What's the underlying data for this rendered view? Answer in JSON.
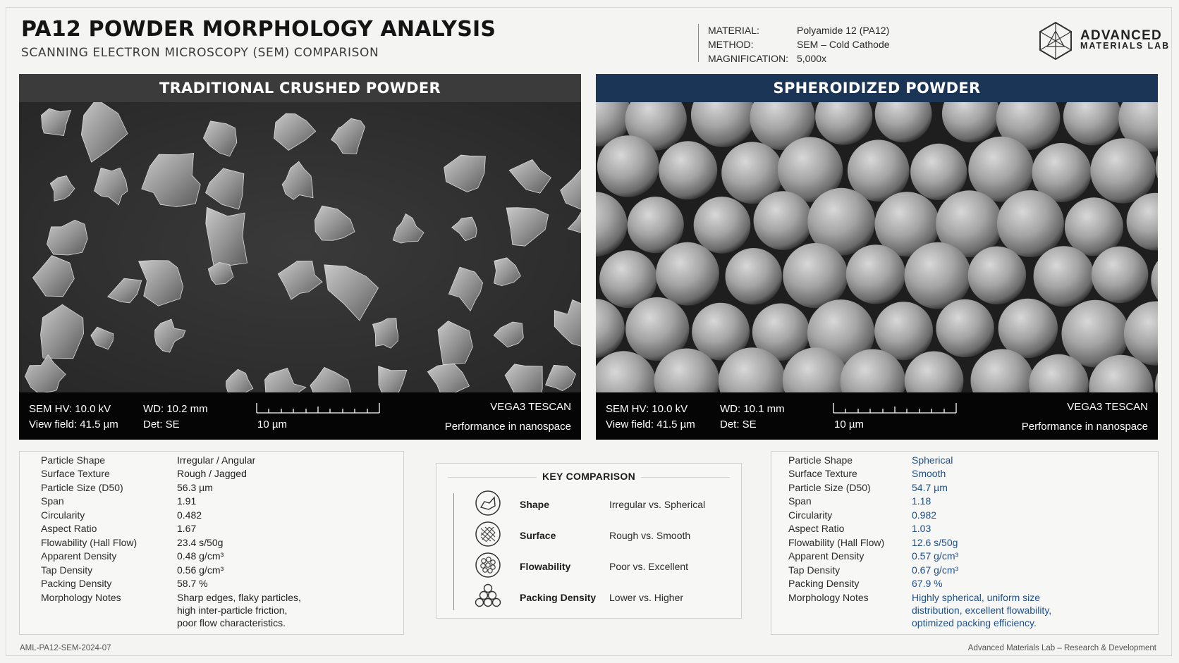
{
  "header": {
    "title": "PA12 POWDER MORPHOLOGY ANALYSIS",
    "subtitle": "SCANNING ELECTRON MICROSCOPY (SEM) COMPARISON",
    "meta": [
      {
        "key": "MATERIAL:",
        "value": "Polyamide 12 (PA12)"
      },
      {
        "key": "METHOD:",
        "value": "SEM – Cold Cathode"
      },
      {
        "key": "MAGNIFICATION:",
        "value": "5,000x"
      }
    ],
    "logo": {
      "line1": "ADVANCED",
      "line2": "MATERIALS LAB",
      "icon": "crystal-logo-icon"
    }
  },
  "panels": {
    "left": {
      "title": "TRADITIONAL CRUSHED POWDER",
      "image": "sem-image-irregular-crushed-particles",
      "sem": {
        "hv": "SEM HV: 10.0 kV",
        "view_field": "View field: 41.5 µm",
        "wd": "WD: 10.2 mm",
        "det": "Det: SE",
        "scale": "10 µm",
        "instrument": "VEGA3 TESCAN",
        "tagline": "Performance in nanospace"
      }
    },
    "right": {
      "title": "SPHEROIDIZED POWDER",
      "image": "sem-image-spherical-particles",
      "sem": {
        "hv": "SEM HV: 10.0 kV",
        "view_field": "View field: 41.5 µm",
        "wd": "WD: 10.1 mm",
        "det": "Det: SE",
        "scale": "10 µm",
        "instrument": "VEGA3 TESCAN",
        "tagline": "Performance in nanospace"
      }
    }
  },
  "properties_left": [
    {
      "key": "Particle Shape",
      "value": "Irregular / Angular"
    },
    {
      "key": "Surface Texture",
      "value": "Rough / Jagged"
    },
    {
      "key": "Particle Size (D50)",
      "value": "56.3 µm"
    },
    {
      "key": "Span",
      "value": "1.91"
    },
    {
      "key": "Circularity",
      "value": "0.482"
    },
    {
      "key": "Aspect Ratio",
      "value": "1.67"
    },
    {
      "key": "Flowability (Hall Flow)",
      "value": "23.4 s/50g"
    },
    {
      "key": "Apparent Density",
      "value": "0.48 g/cm³"
    },
    {
      "key": "Tap Density",
      "value": "0.56 g/cm³"
    },
    {
      "key": "Packing Density",
      "value": "58.7 %"
    },
    {
      "key": "Morphology Notes",
      "value": "Sharp edges, flaky particles,",
      "value2": "high inter-particle friction,",
      "value3": "poor flow characteristics."
    }
  ],
  "properties_right": [
    {
      "key": "Particle Shape",
      "value": "Spherical"
    },
    {
      "key": "Surface Texture",
      "value": "Smooth"
    },
    {
      "key": "Particle Size (D50)",
      "value": "54.7 µm"
    },
    {
      "key": "Span",
      "value": "1.18"
    },
    {
      "key": "Circularity",
      "value": "0.982"
    },
    {
      "key": "Aspect Ratio",
      "value": "1.03"
    },
    {
      "key": "Flowability (Hall Flow)",
      "value": "12.6 s/50g"
    },
    {
      "key": "Apparent Density",
      "value": "0.57 g/cm³"
    },
    {
      "key": "Tap Density",
      "value": "0.67 g/cm³"
    },
    {
      "key": "Packing Density",
      "value": "67.9 %"
    },
    {
      "key": "Morphology Notes",
      "value": "Highly spherical, uniform size",
      "value2": "distribution, excellent flowability,",
      "value3": "optimized packing efficiency."
    }
  ],
  "key_comparison": {
    "title": "KEY COMPARISON",
    "items": [
      {
        "icon": "shape-icon",
        "label": "Shape",
        "value": "Irregular vs. Spherical"
      },
      {
        "icon": "surface-icon",
        "label": "Surface",
        "value": "Rough vs. Smooth"
      },
      {
        "icon": "flowability-icon",
        "label": "Flowability",
        "value": "Poor vs. Excellent"
      },
      {
        "icon": "packing-density-icon",
        "label": "Packing Density",
        "value": "Lower vs. Higher"
      }
    ]
  },
  "footer": {
    "left": "AML-PA12-SEM-2024-07",
    "right": "Advanced Materials Lab – Research & Development"
  },
  "colors": {
    "left_header": "#3b3b3b",
    "right_header": "#1b3556",
    "right_values": "#1e4f8a"
  }
}
